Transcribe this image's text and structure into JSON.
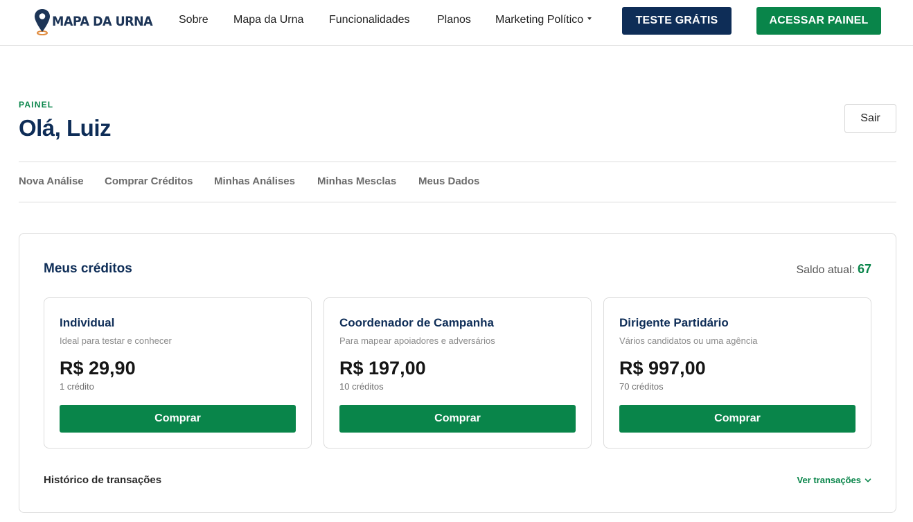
{
  "header": {
    "logo_text": "MAPA DA URNA",
    "nav": [
      "Sobre",
      "Mapa da Urna",
      "Funcionalidades",
      "Planos",
      "Marketing Político"
    ],
    "trial_button": "TESTE GRÁTIS",
    "panel_button": "ACESSAR PAINEL"
  },
  "page": {
    "eyebrow": "PAINEL",
    "greeting": "Olá, Luiz",
    "exit_button": "Sair"
  },
  "tabs": [
    "Nova Análise",
    "Comprar Créditos",
    "Minhas Análises",
    "Minhas Mesclas",
    "Meus Dados"
  ],
  "credits": {
    "title": "Meus créditos",
    "balance_label": "Saldo atual:",
    "balance_value": "67",
    "plans": [
      {
        "name": "Individual",
        "description": "Ideal para testar e conhecer",
        "price": "R$ 29,90",
        "credits": "1 crédito",
        "button": "Comprar"
      },
      {
        "name": "Coordenador de Campanha",
        "description": "Para mapear apoiadores e adversários",
        "price": "R$ 197,00",
        "credits": "10 créditos",
        "button": "Comprar"
      },
      {
        "name": "Dirigente Partidário",
        "description": "Vários candidatos ou uma agência",
        "price": "R$ 997,00",
        "credits": "70 créditos",
        "button": "Comprar"
      }
    ],
    "history_label": "Histórico de transações",
    "history_link": "Ver transações"
  },
  "colors": {
    "brand_navy": "#0e2d57",
    "brand_green": "#09854a",
    "logo_pin_orange": "#e08a3c"
  },
  "icons": {
    "logo": "map-pin-icon",
    "nav_dropdown": "caret-down-icon",
    "history_toggle": "chevron-down-icon"
  }
}
